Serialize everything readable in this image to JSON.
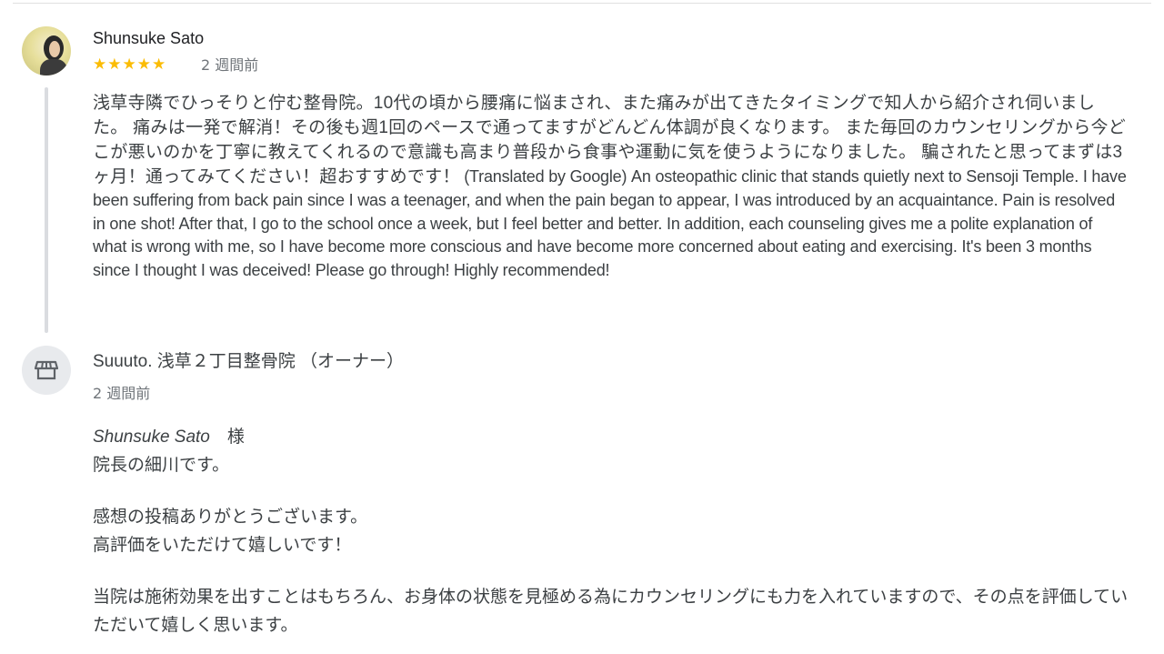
{
  "review": {
    "reviewer_name": "Shunsuke Sato",
    "rating_stars": "★★★★★",
    "rating": 5,
    "date": "2 週間前",
    "text_ja": "浅草寺隣でひっそりと佇む整骨院。10代の頃から腰痛に悩まされ、また痛みが出てきたタイミングで知人から紹介され伺いました。 痛みは一発で解消！その後も週1回のペースで通ってますがどんどん体調が良くなります。 また毎回のカウンセリングから今どこが悪いのかを丁寧に教えてくれるので意識も高まり普段から食事や運動に気を使うようになりました。 騙されたと思ってまずは3ヶ月！通ってみてください！超おすすめです！",
    "text_en": "(Translated by Google) An osteopathic clinic that stands quietly next to Sensoji Temple. I have been suffering from back pain since I was a teenager, and when the pain began to appear, I was introduced by an acquaintance. Pain is resolved in one shot! After that, I go to the school once a week, but I feel better and better. In addition, each counseling gives me a polite explanation of what is wrong with me, so I have become more conscious and have become more concerned about eating and exercising. It's been 3 months since I thought I was deceived! Please go through! Highly recommended!"
  },
  "owner_reply": {
    "owner_name": "Suuuto. 浅草２丁目整骨院 （オーナー）",
    "date": "2 週間前",
    "customer_name": "Shunsuke Sato",
    "honorific": "様",
    "lines": {
      "intro": "院長の細川です。",
      "thanks": "感想の投稿ありがとうございます。",
      "happy": "高評価をいただけて嬉しいです！",
      "body": "当院は施術効果を出すことはもちろん、お身体の状態を見極める為にカウンセリングにも力を入れていますので、その点を評価していただいて嬉しく思います。"
    }
  },
  "colors": {
    "star": "#fbbc04",
    "text": "#3c4043",
    "meta": "#70757a",
    "thread": "#dadce0"
  }
}
